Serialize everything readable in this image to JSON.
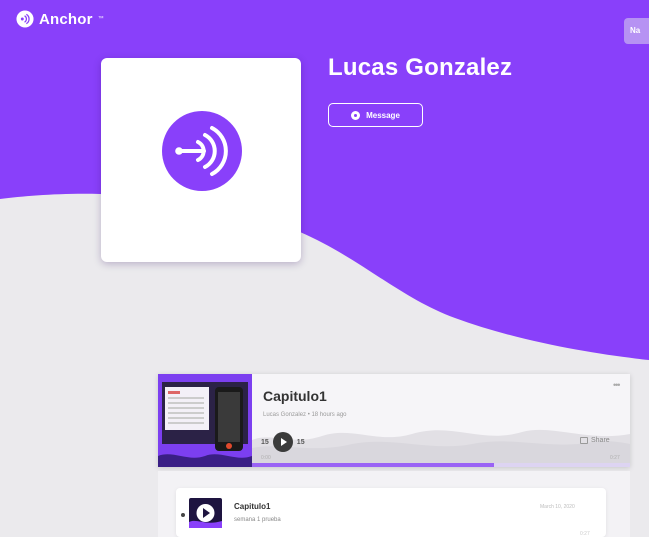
{
  "brand": {
    "name": "Anchor",
    "trademark": "™",
    "accent": "#8940fa"
  },
  "header": {
    "corner_button_label": "Na"
  },
  "profile": {
    "title": "Lucas Gonzalez",
    "message_label": "Message",
    "cover_icon": "anchor-signal-icon"
  },
  "player": {
    "episode_title": "Capitulo1",
    "meta": "Lucas Gonzalez • 18 hours ago",
    "skip_back_label": "15",
    "skip_forward_label": "15",
    "share_label": "Share",
    "more_label": "•••",
    "time_elapsed": "0:00",
    "time_total": "0:27",
    "progress": 0.64
  },
  "episodes": [
    {
      "title": "Capitulo1",
      "description": "semana 1 prueba",
      "date": "March 10, 2020",
      "duration": "0:27"
    }
  ],
  "colors": {
    "purple": "#8940fa",
    "background": "#ebeaed",
    "card": "#ffffff"
  }
}
